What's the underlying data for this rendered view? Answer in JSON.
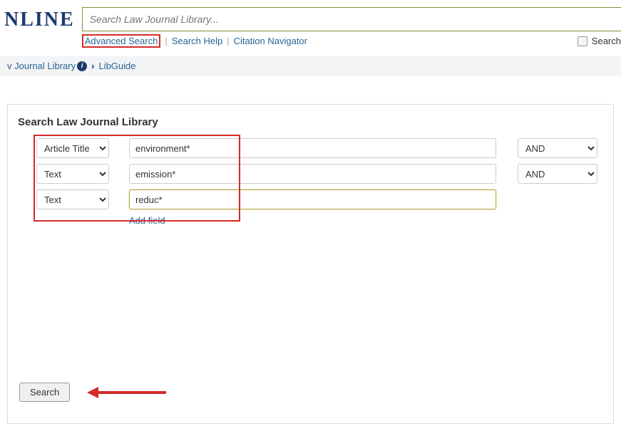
{
  "header": {
    "logo_text": "NLINE",
    "search_placeholder": "Search Law Journal Library...",
    "links": {
      "advanced": "Advanced Search",
      "help": "Search Help",
      "citation": "Citation Navigator"
    },
    "search_label": "Search"
  },
  "breadcrumb": {
    "item1": "v Journal Library",
    "item2": "LibGuide"
  },
  "panel": {
    "title": "Search Law Journal Library",
    "rows": [
      {
        "field": "Article Title",
        "term": "environment*",
        "op": "AND"
      },
      {
        "field": "Text",
        "term": "emission*",
        "op": "AND"
      },
      {
        "field": "Text",
        "term": "reduc*"
      }
    ],
    "add_field": "Add field",
    "search_button": "Search"
  }
}
